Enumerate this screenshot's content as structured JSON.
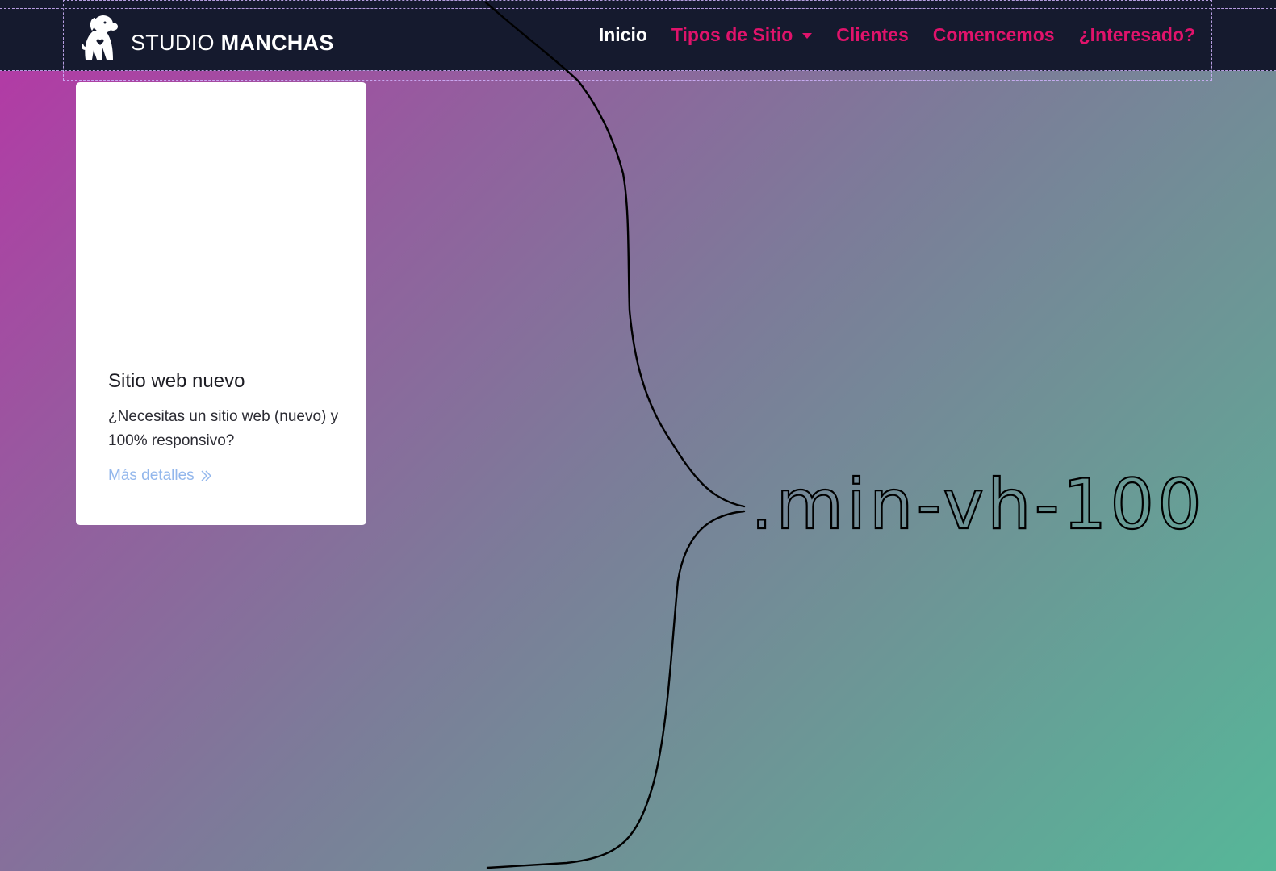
{
  "brand": {
    "name_light": "STUDIO",
    "name_bold": "MANCHAS",
    "logo_icon": "dog-logo-icon"
  },
  "nav": {
    "items": [
      {
        "label": "Inicio",
        "active": true
      },
      {
        "label": "Tipos de Sitio",
        "dropdown": true
      },
      {
        "label": "Clientes"
      },
      {
        "label": "Comencemos"
      },
      {
        "label": "¿Interesado?"
      }
    ]
  },
  "card": {
    "title": "Sitio web nuevo",
    "text": "¿Necesitas un sitio web (nuevo) y 100% responsivo?",
    "link": "Más detalles",
    "link_icon": "double-chevron-right-icon"
  },
  "annotation": {
    "text": ".min-vh-100"
  },
  "colors": {
    "navbar_bg": "#151a2e",
    "nav_accent": "#e0136b",
    "nav_active": "#ffffff",
    "link_color": "#93b7ec",
    "gradient_start": "#b636a6",
    "gradient_end": "#56b798"
  }
}
